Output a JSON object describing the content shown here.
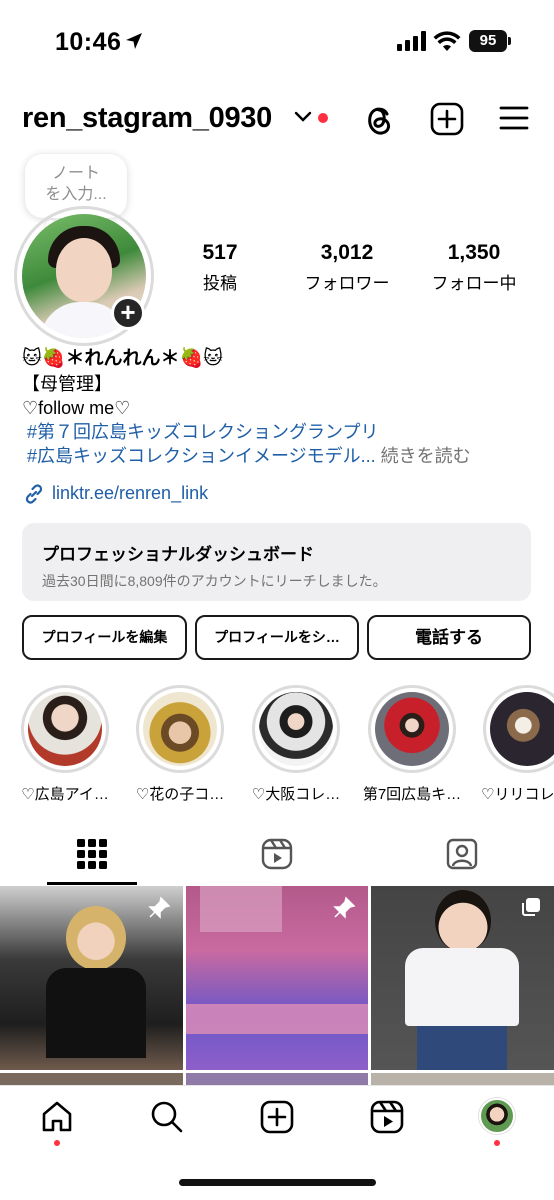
{
  "status_bar": {
    "time": "10:46",
    "battery": "95"
  },
  "header": {
    "username": "ren_stagram_0930"
  },
  "note": {
    "line1": "ノート",
    "line2": "を入力..."
  },
  "stats": [
    {
      "value": "517",
      "label": "投稿"
    },
    {
      "value": "3,012",
      "label": "フォロワー"
    },
    {
      "value": "1,350",
      "label": "フォロー中"
    }
  ],
  "bio": {
    "name": "🐱🍓＊れんれん＊🍓🐱",
    "line1": "【母管理】",
    "line2": "♡follow me♡",
    "hashtag1": "#第７回広島キッズコレクショングランプリ",
    "hashtag2": "#広島キッズコレクションイメージモデル...",
    "more": "続きを読む",
    "link": "linktr.ee/renren_link"
  },
  "dashboard": {
    "title": "プロフェッショナルダッシュボード",
    "subtitle": "過去30日間に8,809件のアカウントにリーチしました。"
  },
  "buttons": {
    "edit": "プロフィールを編集",
    "share": "プロフィールをシ…",
    "call": "電話する"
  },
  "highlights": [
    {
      "label": "♡広島アイ…"
    },
    {
      "label": "♡花の子コ…"
    },
    {
      "label": "♡大阪コレ…"
    },
    {
      "label": "第7回広島キ…"
    },
    {
      "label": "♡リリコレクション"
    }
  ],
  "colors": {
    "link": "#1f5fa8",
    "notification_dot": "#ff3040",
    "dashboard_bg": "#efeff1"
  },
  "icons": [
    "location-arrow-icon",
    "cellular-signal-icon",
    "wifi-icon",
    "chevron-down-icon",
    "threads-icon",
    "plus-square-icon",
    "hamburger-menu-icon",
    "grid-icon",
    "reels-icon",
    "tagged-icon",
    "pin-icon",
    "carousel-icon",
    "home-icon",
    "search-icon",
    "create-icon"
  ]
}
